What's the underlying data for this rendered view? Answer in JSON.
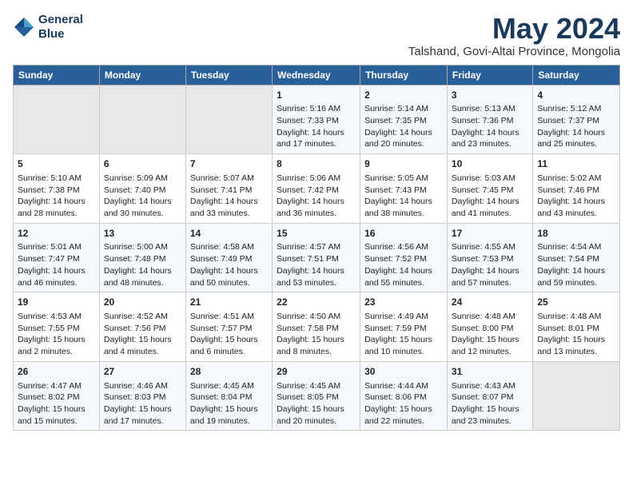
{
  "header": {
    "logo_line1": "General",
    "logo_line2": "Blue",
    "month_title": "May 2024",
    "subtitle": "Talshand, Govi-Altai Province, Mongolia"
  },
  "days_of_week": [
    "Sunday",
    "Monday",
    "Tuesday",
    "Wednesday",
    "Thursday",
    "Friday",
    "Saturday"
  ],
  "weeks": [
    [
      {
        "day": "",
        "data": ""
      },
      {
        "day": "",
        "data": ""
      },
      {
        "day": "",
        "data": ""
      },
      {
        "day": "1",
        "data": "Sunrise: 5:16 AM\nSunset: 7:33 PM\nDaylight: 14 hours\nand 17 minutes."
      },
      {
        "day": "2",
        "data": "Sunrise: 5:14 AM\nSunset: 7:35 PM\nDaylight: 14 hours\nand 20 minutes."
      },
      {
        "day": "3",
        "data": "Sunrise: 5:13 AM\nSunset: 7:36 PM\nDaylight: 14 hours\nand 23 minutes."
      },
      {
        "day": "4",
        "data": "Sunrise: 5:12 AM\nSunset: 7:37 PM\nDaylight: 14 hours\nand 25 minutes."
      }
    ],
    [
      {
        "day": "5",
        "data": "Sunrise: 5:10 AM\nSunset: 7:38 PM\nDaylight: 14 hours\nand 28 minutes."
      },
      {
        "day": "6",
        "data": "Sunrise: 5:09 AM\nSunset: 7:40 PM\nDaylight: 14 hours\nand 30 minutes."
      },
      {
        "day": "7",
        "data": "Sunrise: 5:07 AM\nSunset: 7:41 PM\nDaylight: 14 hours\nand 33 minutes."
      },
      {
        "day": "8",
        "data": "Sunrise: 5:06 AM\nSunset: 7:42 PM\nDaylight: 14 hours\nand 36 minutes."
      },
      {
        "day": "9",
        "data": "Sunrise: 5:05 AM\nSunset: 7:43 PM\nDaylight: 14 hours\nand 38 minutes."
      },
      {
        "day": "10",
        "data": "Sunrise: 5:03 AM\nSunset: 7:45 PM\nDaylight: 14 hours\nand 41 minutes."
      },
      {
        "day": "11",
        "data": "Sunrise: 5:02 AM\nSunset: 7:46 PM\nDaylight: 14 hours\nand 43 minutes."
      }
    ],
    [
      {
        "day": "12",
        "data": "Sunrise: 5:01 AM\nSunset: 7:47 PM\nDaylight: 14 hours\nand 46 minutes."
      },
      {
        "day": "13",
        "data": "Sunrise: 5:00 AM\nSunset: 7:48 PM\nDaylight: 14 hours\nand 48 minutes."
      },
      {
        "day": "14",
        "data": "Sunrise: 4:58 AM\nSunset: 7:49 PM\nDaylight: 14 hours\nand 50 minutes."
      },
      {
        "day": "15",
        "data": "Sunrise: 4:57 AM\nSunset: 7:51 PM\nDaylight: 14 hours\nand 53 minutes."
      },
      {
        "day": "16",
        "data": "Sunrise: 4:56 AM\nSunset: 7:52 PM\nDaylight: 14 hours\nand 55 minutes."
      },
      {
        "day": "17",
        "data": "Sunrise: 4:55 AM\nSunset: 7:53 PM\nDaylight: 14 hours\nand 57 minutes."
      },
      {
        "day": "18",
        "data": "Sunrise: 4:54 AM\nSunset: 7:54 PM\nDaylight: 14 hours\nand 59 minutes."
      }
    ],
    [
      {
        "day": "19",
        "data": "Sunrise: 4:53 AM\nSunset: 7:55 PM\nDaylight: 15 hours\nand 2 minutes."
      },
      {
        "day": "20",
        "data": "Sunrise: 4:52 AM\nSunset: 7:56 PM\nDaylight: 15 hours\nand 4 minutes."
      },
      {
        "day": "21",
        "data": "Sunrise: 4:51 AM\nSunset: 7:57 PM\nDaylight: 15 hours\nand 6 minutes."
      },
      {
        "day": "22",
        "data": "Sunrise: 4:50 AM\nSunset: 7:58 PM\nDaylight: 15 hours\nand 8 minutes."
      },
      {
        "day": "23",
        "data": "Sunrise: 4:49 AM\nSunset: 7:59 PM\nDaylight: 15 hours\nand 10 minutes."
      },
      {
        "day": "24",
        "data": "Sunrise: 4:48 AM\nSunset: 8:00 PM\nDaylight: 15 hours\nand 12 minutes."
      },
      {
        "day": "25",
        "data": "Sunrise: 4:48 AM\nSunset: 8:01 PM\nDaylight: 15 hours\nand 13 minutes."
      }
    ],
    [
      {
        "day": "26",
        "data": "Sunrise: 4:47 AM\nSunset: 8:02 PM\nDaylight: 15 hours\nand 15 minutes."
      },
      {
        "day": "27",
        "data": "Sunrise: 4:46 AM\nSunset: 8:03 PM\nDaylight: 15 hours\nand 17 minutes."
      },
      {
        "day": "28",
        "data": "Sunrise: 4:45 AM\nSunset: 8:04 PM\nDaylight: 15 hours\nand 19 minutes."
      },
      {
        "day": "29",
        "data": "Sunrise: 4:45 AM\nSunset: 8:05 PM\nDaylight: 15 hours\nand 20 minutes."
      },
      {
        "day": "30",
        "data": "Sunrise: 4:44 AM\nSunset: 8:06 PM\nDaylight: 15 hours\nand 22 minutes."
      },
      {
        "day": "31",
        "data": "Sunrise: 4:43 AM\nSunset: 8:07 PM\nDaylight: 15 hours\nand 23 minutes."
      },
      {
        "day": "",
        "data": ""
      }
    ]
  ]
}
